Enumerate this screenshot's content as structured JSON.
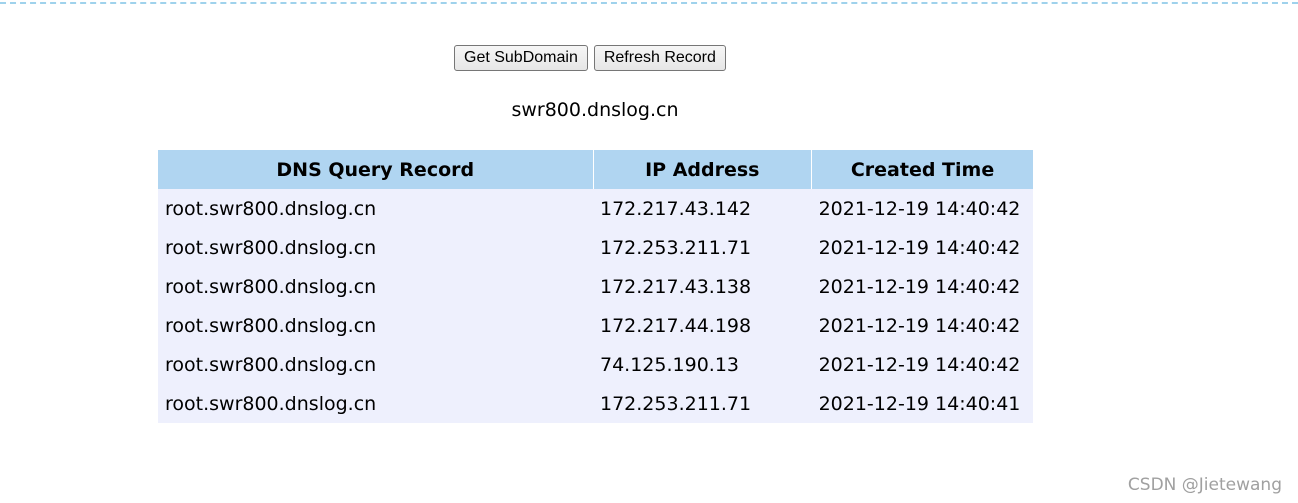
{
  "buttons": {
    "get_subdomain": "Get SubDomain",
    "refresh_record": "Refresh Record"
  },
  "subdomain": "swr800.dnslog.cn",
  "table": {
    "headers": [
      "DNS Query Record",
      "IP Address",
      "Created Time"
    ],
    "rows": [
      {
        "query": "root.swr800.dnslog.cn",
        "ip": "172.217.43.142",
        "time": "2021-12-19 14:40:42"
      },
      {
        "query": "root.swr800.dnslog.cn",
        "ip": "172.253.211.71",
        "time": "2021-12-19 14:40:42"
      },
      {
        "query": "root.swr800.dnslog.cn",
        "ip": "172.217.43.138",
        "time": "2021-12-19 14:40:42"
      },
      {
        "query": "root.swr800.dnslog.cn",
        "ip": "172.217.44.198",
        "time": "2021-12-19 14:40:42"
      },
      {
        "query": "root.swr800.dnslog.cn",
        "ip": "74.125.190.13",
        "time": "2021-12-19 14:40:42"
      },
      {
        "query": "root.swr800.dnslog.cn",
        "ip": "172.253.211.71",
        "time": "2021-12-19 14:40:41"
      }
    ]
  },
  "watermark": "CSDN @Jietewang",
  "colors": {
    "header_bg": "#b0d5f1",
    "row_bg": "#eef0fd",
    "top_border": "#9fd2ec"
  }
}
